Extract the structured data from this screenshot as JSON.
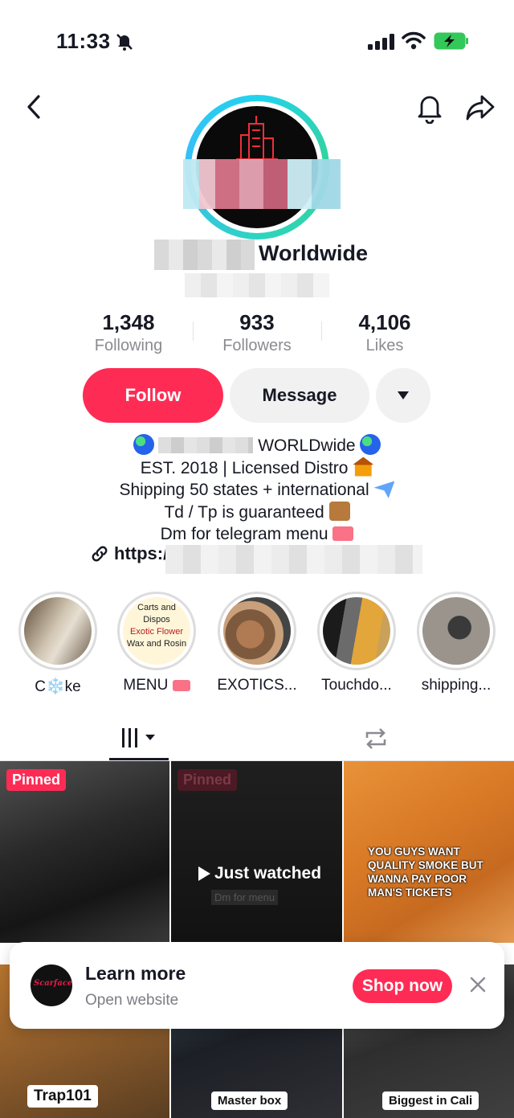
{
  "status_bar": {
    "time": "11:33"
  },
  "profile": {
    "display_name_visible": "Worldwide",
    "stats": [
      {
        "value": "1,348",
        "label": "Following"
      },
      {
        "value": "933",
        "label": "Followers"
      },
      {
        "value": "4,106",
        "label": "Likes"
      }
    ]
  },
  "actions": {
    "follow": "Follow",
    "message": "Message"
  },
  "bio": {
    "line1": "WORLDwide",
    "line2": "EST. 2018 | Licensed Distro",
    "line3": "Shipping 50 states + international",
    "line4": "Td / Tp is guaranteed",
    "line5": "Dm for telegram menu",
    "link_prefix": "https:/"
  },
  "highlights": [
    {
      "label": "C❄️ke"
    },
    {
      "label": "MENU"
    },
    {
      "label": "EXOTICS..."
    },
    {
      "label": "Touchdo..."
    },
    {
      "label": "shipping..."
    }
  ],
  "menu_card": {
    "l1": "Carts and",
    "l2": "Dispos",
    "l3": "Exotic Flower",
    "l4": "Wax and Rosin"
  },
  "videos": {
    "pinned_label": "Pinned",
    "just_watched": "Just watched",
    "overlay_sub": "Dm for menu",
    "tile3_text": "YOU GUYS WANT QUALITY SMOKE BUT WANNA PAY POOR MAN'S TICKETS",
    "captions": [
      "Trap101",
      "Master box",
      "Biggest in Cali"
    ]
  },
  "ad": {
    "title": "Learn more",
    "subtitle": "Open website",
    "cta": "Shop now",
    "logo_text": "Scarface"
  },
  "colors": {
    "accent": "#fe2c55",
    "ring": "#22d3ee",
    "muted": "#8a8b91"
  }
}
